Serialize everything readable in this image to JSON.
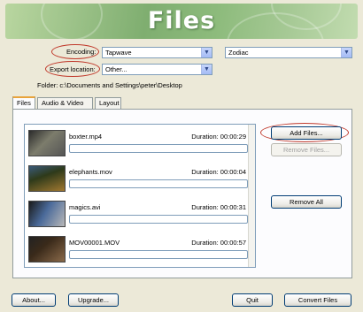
{
  "header": {
    "title": "Files"
  },
  "encoding": {
    "label": "Encoding:",
    "device": "Tapwave",
    "model": "Zodiac"
  },
  "export": {
    "label": "Export location:",
    "value": "Other..."
  },
  "folder": {
    "text": "Folder: c:\\Documents and Settings\\peter\\Desktop"
  },
  "tabs": [
    {
      "label": "Files",
      "active": true
    },
    {
      "label": "Audio & Video",
      "active": false
    },
    {
      "label": "Layout",
      "active": false
    }
  ],
  "files": [
    {
      "name": "boxter.mp4",
      "duration": "Duration: 00:00:29",
      "progress": 0,
      "thumb": [
        "#2b2b2b",
        "#7c7c6c",
        "#555"
      ]
    },
    {
      "name": "elephants.mov",
      "duration": "Duration: 00:00:04",
      "progress": 0,
      "thumb": [
        "#2e3a1a",
        "#a07830",
        "#3a5a7a"
      ]
    },
    {
      "name": "magics.avi",
      "duration": "Duration: 00:00:31",
      "progress": 0,
      "thumb": [
        "#1a1a1a",
        "#b8b8b8",
        "#4a6a9a"
      ]
    },
    {
      "name": "MOV00001.MOV",
      "duration": "Duration: 00:00:57",
      "progress": 0,
      "thumb": [
        "#3a2a1a",
        "#8a6a4a",
        "#222"
      ]
    }
  ],
  "buttons": {
    "add_files": "Add Files...",
    "remove_files": "Remove Files...",
    "remove_all": "Remove All",
    "about": "About...",
    "upgrade": "Upgrade...",
    "quit": "Quit",
    "convert": "Convert Files"
  }
}
